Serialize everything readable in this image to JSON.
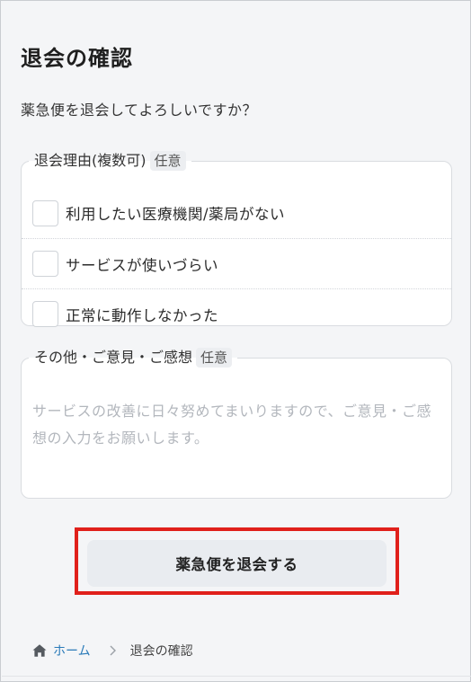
{
  "page": {
    "title": "退会の確認",
    "prompt": "薬急便を退会してよろしいですか？"
  },
  "reasons": {
    "legend": "退会理由(複数可)",
    "badge": "任意",
    "items": [
      {
        "label": "利用したい医療機関/薬局がない",
        "checked": false
      },
      {
        "label": "サービスが使いづらい",
        "checked": false
      },
      {
        "label": "正常に動作しなかった",
        "checked": false
      }
    ]
  },
  "comment": {
    "legend": "その他・ご意見・ご感想",
    "badge": "任意",
    "placeholder": "サービスの改善に日々努めてまいりますので、ご意見・ご感想の入力をお願いします。",
    "value": ""
  },
  "submit": {
    "label": "薬急便を退会する",
    "highlight_color": "#e0201b"
  },
  "breadcrumb": {
    "home_icon": "home-icon",
    "home_label": "ホーム",
    "separator_icon": "chevron-right-icon",
    "current_label": "退会の確認"
  }
}
